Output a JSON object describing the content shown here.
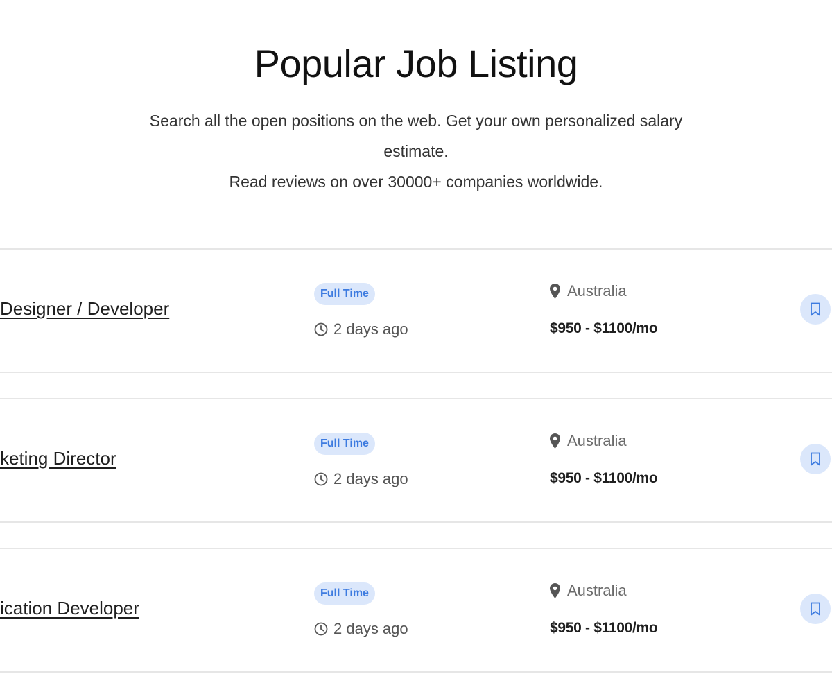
{
  "header": {
    "title": "Popular Job Listing",
    "subtitle_line1": "Search all the open positions on the web. Get your own personalized salary estimate.",
    "subtitle_line2": "Read reviews on over 30000+ companies worldwide."
  },
  "colors": {
    "accent": "#3d7be0",
    "badge_bg": "#dbe7fb"
  },
  "jobs": [
    {
      "title": "Designer / Developer",
      "type": "Full Time",
      "posted": "2 days ago",
      "location": "Australia",
      "salary": "$950 - $1100/mo",
      "bookmark_icon": "bookmark-icon"
    },
    {
      "title": "keting Director",
      "type": "Full Time",
      "posted": "2 days ago",
      "location": "Australia",
      "salary": "$950 - $1100/mo",
      "bookmark_icon": "bookmark-icon"
    },
    {
      "title": "ication Developer",
      "type": "Full Time",
      "posted": "2 days ago",
      "location": "Australia",
      "salary": "$950 - $1100/mo",
      "bookmark_icon": "bookmark-icon"
    }
  ]
}
